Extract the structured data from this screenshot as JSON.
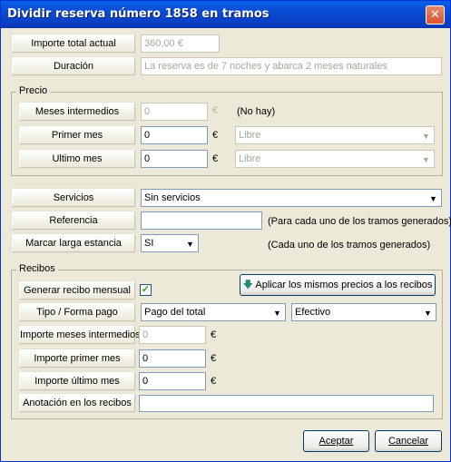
{
  "window": {
    "title": "Dividir reserva número 1858 en tramos",
    "close_glyph": "✕"
  },
  "top": {
    "importe_label": "Importe total actual",
    "importe_value": "360,00 €",
    "duracion_label": "Duración",
    "duracion_value": "La reserva es de 7 noches y abarca 2 meses naturales"
  },
  "precio": {
    "group_title": "Precio",
    "meses_label": "Meses intermedios",
    "meses_value": "0",
    "meses_euro": "€",
    "meses_note": "(No hay)",
    "primer_label": "Primer mes",
    "primer_value": "0",
    "primer_euro": "€",
    "primer_option": "Libre",
    "ultimo_label": "Ultimo mes",
    "ultimo_value": "0",
    "ultimo_euro": "€",
    "ultimo_option": "Libre"
  },
  "middle": {
    "servicios_label": "Servicios",
    "servicios_value": "Sin servicios",
    "referencia_label": "Referencia",
    "referencia_value": "",
    "referencia_note": "(Para cada uno de los tramos generados)",
    "larga_label": "Marcar larga estancia",
    "larga_value": "SI",
    "larga_note": "(Cada uno de los tramos generados)"
  },
  "recibos": {
    "group_title": "Recibos",
    "generar_label": "Generar recibo mensual",
    "generar_checked": "✓",
    "aplicar_button": "Aplicar los mismos precios a los recibos",
    "tipo_label": "Tipo / Forma pago",
    "tipo_value": "Pago del total",
    "forma_value": "Efectivo",
    "imp_meses_label": "Importe meses intermedios",
    "imp_meses_value": "0",
    "imp_meses_euro": "€",
    "imp_primer_label": "Importe primer mes",
    "imp_primer_value": "0",
    "imp_primer_euro": "€",
    "imp_ultimo_label": "Importe último mes",
    "imp_ultimo_value": "0",
    "imp_ultimo_euro": "€",
    "anotacion_label": "Anotación en los recibos",
    "anotacion_value": ""
  },
  "footer": {
    "accept": "Aceptar",
    "cancel": "Cancelar"
  }
}
